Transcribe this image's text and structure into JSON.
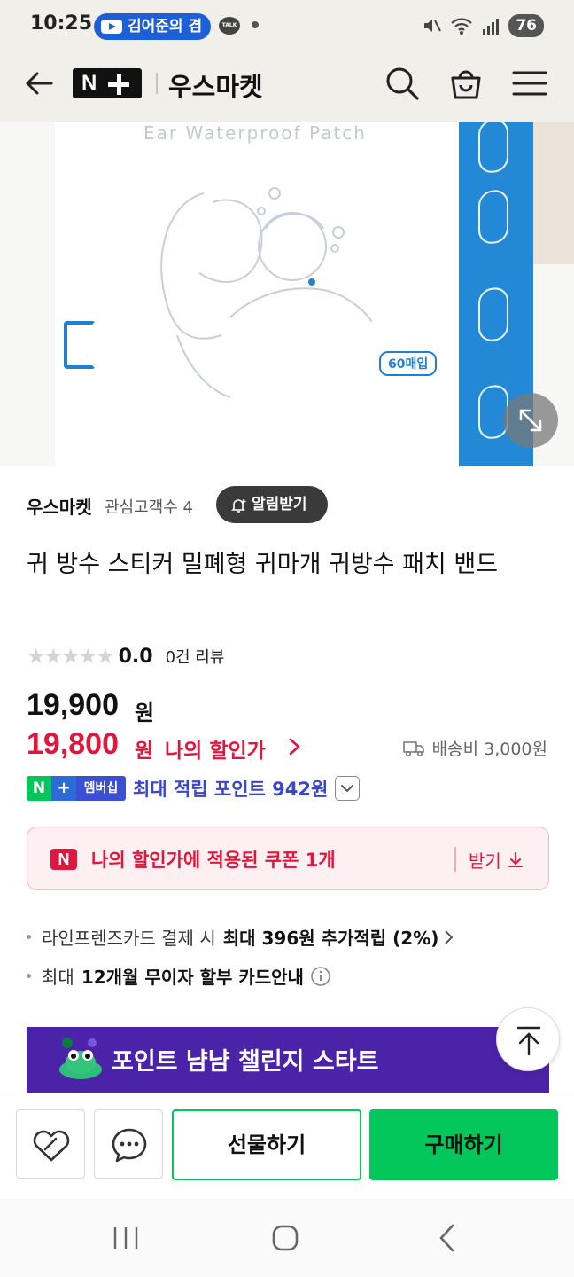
{
  "status_bar": {
    "time": "10:25",
    "notification_pill": "김어준의 겸",
    "talk_label": "TALK",
    "battery": "76"
  },
  "header": {
    "logo_text": "N",
    "store_name": "우스마켓",
    "icons": [
      "back-arrow-icon",
      "search-icon",
      "shopping-bag-icon",
      "menu-icon"
    ]
  },
  "hero": {
    "box_caption": "Ear Waterproof Patch",
    "box_count_badge": "60매입"
  },
  "seller": {
    "name": "우스마켓",
    "followers": "관심고객수 4",
    "alarm_label": "알림받기"
  },
  "product": {
    "title": "귀 방수 스티커 밀폐형 귀마개 귀방수 패치 밴드",
    "rating": 0.0,
    "rating_display": "0.0",
    "stars_filled": 0,
    "stars_total": 5,
    "review_count": "0건 리뷰"
  },
  "price": {
    "original": "19,900",
    "original_unit": "원",
    "sale": "19,800",
    "sale_unit": "원",
    "my_discount_label": "나의 할인가",
    "shipping": "배송비 3,000원"
  },
  "membership": {
    "badge_n": "N",
    "badge_plus": "+",
    "badge_label": "멤버십",
    "points_text": "최대 적립 포인트 942원"
  },
  "coupon": {
    "n_label": "N",
    "text": "나의 할인가에 적용된 쿠폰 1개",
    "receive_label": "받기"
  },
  "benefits": {
    "card_prefix": "라인프렌즈카드 결제 시",
    "card_em": "최대 396원 추가적립 (2%)",
    "installment_prefix": "최대",
    "installment_em": "12개월 무이자 할부 카드안내"
  },
  "banner": {
    "text": "포인트 냠냠 챌린지 스타트"
  },
  "bottom_bar": {
    "gift_label": "선물하기",
    "buy_label": "구매하기"
  },
  "colors": {
    "naver_green": "#03c75a",
    "sale_red": "#e0163c",
    "point_blue": "#3b46c8",
    "banner_purple": "#4b23a8",
    "header_bg": "#f1efea"
  }
}
